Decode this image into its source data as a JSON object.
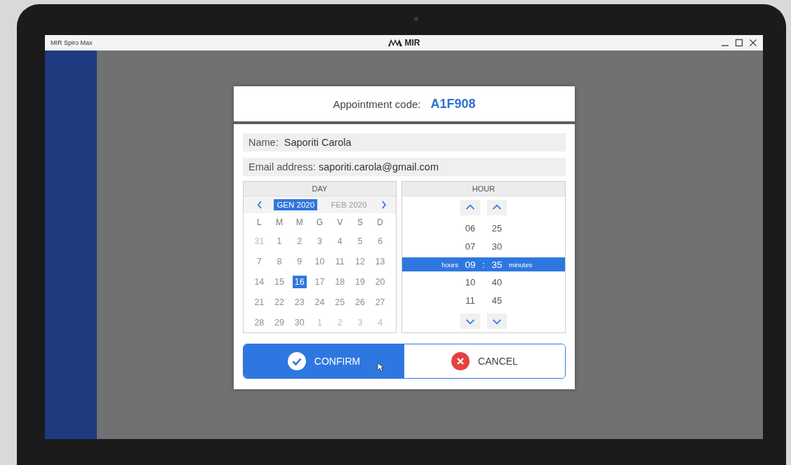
{
  "window": {
    "title": "MIR Spiro Max",
    "brand": "MIR"
  },
  "dialog": {
    "code_label": "Appointment code:",
    "code": "A1F908",
    "fields": [
      {
        "label": "Name:",
        "value": "Saporiti Carola"
      },
      {
        "label": "Email address:",
        "value": "saporiti.carola@gmail.com"
      }
    ],
    "day_picker": {
      "title": "DAY",
      "months": [
        {
          "label": "GEN 2020",
          "selected": true
        },
        {
          "label": "FEB 2020",
          "selected": false
        }
      ],
      "weekdays": [
        "L",
        "M",
        "M",
        "G",
        "V",
        "S",
        "D"
      ],
      "days": [
        {
          "label": "31",
          "outside_month": true,
          "selected": false
        },
        {
          "label": "1",
          "outside_month": false,
          "selected": false
        },
        {
          "label": "2",
          "outside_month": false,
          "selected": false
        },
        {
          "label": "3",
          "outside_month": false,
          "selected": false
        },
        {
          "label": "4",
          "outside_month": false,
          "selected": false
        },
        {
          "label": "5",
          "outside_month": false,
          "selected": false
        },
        {
          "label": "6",
          "outside_month": false,
          "selected": false
        },
        {
          "label": "7",
          "outside_month": false,
          "selected": false
        },
        {
          "label": "8",
          "outside_month": false,
          "selected": false
        },
        {
          "label": "9",
          "outside_month": false,
          "selected": false
        },
        {
          "label": "10",
          "outside_month": false,
          "selected": false
        },
        {
          "label": "11",
          "outside_month": false,
          "selected": false
        },
        {
          "label": "12",
          "outside_month": false,
          "selected": false
        },
        {
          "label": "13",
          "outside_month": false,
          "selected": false
        },
        {
          "label": "14",
          "outside_month": false,
          "selected": false
        },
        {
          "label": "15",
          "outside_month": false,
          "selected": false
        },
        {
          "label": "16",
          "outside_month": false,
          "selected": true
        },
        {
          "label": "17",
          "outside_month": false,
          "selected": false
        },
        {
          "label": "18",
          "outside_month": false,
          "selected": false
        },
        {
          "label": "19",
          "outside_month": false,
          "selected": false
        },
        {
          "label": "20",
          "outside_month": false,
          "selected": false
        },
        {
          "label": "21",
          "outside_month": false,
          "selected": false
        },
        {
          "label": "22",
          "outside_month": false,
          "selected": false
        },
        {
          "label": "23",
          "outside_month": false,
          "selected": false
        },
        {
          "label": "24",
          "outside_month": false,
          "selected": false
        },
        {
          "label": "25",
          "outside_month": false,
          "selected": false
        },
        {
          "label": "26",
          "outside_month": false,
          "selected": false
        },
        {
          "label": "27",
          "outside_month": false,
          "selected": false
        },
        {
          "label": "28",
          "outside_month": false,
          "selected": false
        },
        {
          "label": "29",
          "outside_month": false,
          "selected": false
        },
        {
          "label": "30",
          "outside_month": false,
          "selected": false
        },
        {
          "label": "1",
          "outside_month": true,
          "selected": false
        },
        {
          "label": "2",
          "outside_month": true,
          "selected": false
        },
        {
          "label": "3",
          "outside_month": true,
          "selected": false
        },
        {
          "label": "4",
          "outside_month": true,
          "selected": false
        }
      ]
    },
    "hour_picker": {
      "title": "HOUR",
      "hours_label": "hours",
      "minutes_label": "minutes",
      "separator": ":",
      "rows": [
        {
          "hour": "06",
          "minute": "25",
          "selected": false
        },
        {
          "hour": "07",
          "minute": "30",
          "selected": false
        },
        {
          "hour": "09",
          "minute": "35",
          "selected": true
        },
        {
          "hour": "10",
          "minute": "40",
          "selected": false
        },
        {
          "hour": "11",
          "minute": "45",
          "selected": false
        }
      ]
    },
    "buttons": [
      {
        "kind": "confirm",
        "label": "CONFIRM"
      },
      {
        "kind": "cancel",
        "label": "CANCEL"
      }
    ]
  }
}
